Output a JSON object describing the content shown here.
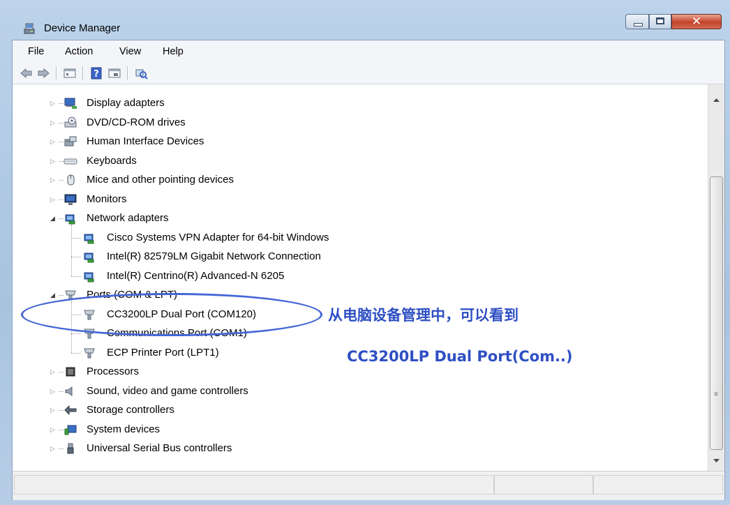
{
  "window": {
    "title": "Device Manager"
  },
  "menubar": [
    {
      "label": "File"
    },
    {
      "label": "Action"
    },
    {
      "label": "View"
    },
    {
      "label": "Help"
    }
  ],
  "toolbar": {
    "buttons": [
      "back-icon",
      "forward-icon",
      "properties-icon",
      "help-icon",
      "update-driver-icon",
      "scan-hardware-icon"
    ]
  },
  "tree": {
    "nodes": [
      {
        "label": "Display adapters",
        "icon": "display-adapter-icon",
        "expanded": false
      },
      {
        "label": "DVD/CD-ROM drives",
        "icon": "dvd-drive-icon",
        "expanded": false
      },
      {
        "label": "Human Interface Devices",
        "icon": "hid-icon",
        "expanded": false
      },
      {
        "label": "Keyboards",
        "icon": "keyboard-icon",
        "expanded": false
      },
      {
        "label": "Mice and other pointing devices",
        "icon": "mouse-icon",
        "expanded": false
      },
      {
        "label": "Monitors",
        "icon": "monitor-icon",
        "expanded": false
      },
      {
        "label": "Network adapters",
        "icon": "network-adapter-icon",
        "expanded": true,
        "children": [
          {
            "label": "Cisco Systems VPN Adapter for 64-bit Windows",
            "icon": "network-adapter-icon"
          },
          {
            "label": "Intel(R) 82579LM Gigabit Network Connection",
            "icon": "network-adapter-icon"
          },
          {
            "label": "Intel(R) Centrino(R) Advanced-N 6205",
            "icon": "network-adapter-icon"
          }
        ]
      },
      {
        "label": "Ports (COM & LPT)",
        "icon": "port-icon",
        "expanded": true,
        "children": [
          {
            "label": "CC3200LP Dual Port (COM120)",
            "icon": "port-icon"
          },
          {
            "label": "Communications Port (COM1)",
            "icon": "port-icon"
          },
          {
            "label": "ECP Printer Port (LPT1)",
            "icon": "port-icon"
          }
        ]
      },
      {
        "label": "Processors",
        "icon": "processor-icon",
        "expanded": false
      },
      {
        "label": "Sound, video and game controllers",
        "icon": "sound-icon",
        "expanded": false
      },
      {
        "label": "Storage controllers",
        "icon": "storage-controller-icon",
        "expanded": false
      },
      {
        "label": "System devices",
        "icon": "system-device-icon",
        "expanded": false
      },
      {
        "label": "Universal Serial Bus controllers",
        "icon": "usb-icon",
        "expanded": false
      }
    ]
  },
  "annotation": {
    "line1": "从电脑设备管理中，可以看到",
    "line2": "CC3200LP Dual Port(Com..)",
    "color": "#2e4fc4"
  }
}
